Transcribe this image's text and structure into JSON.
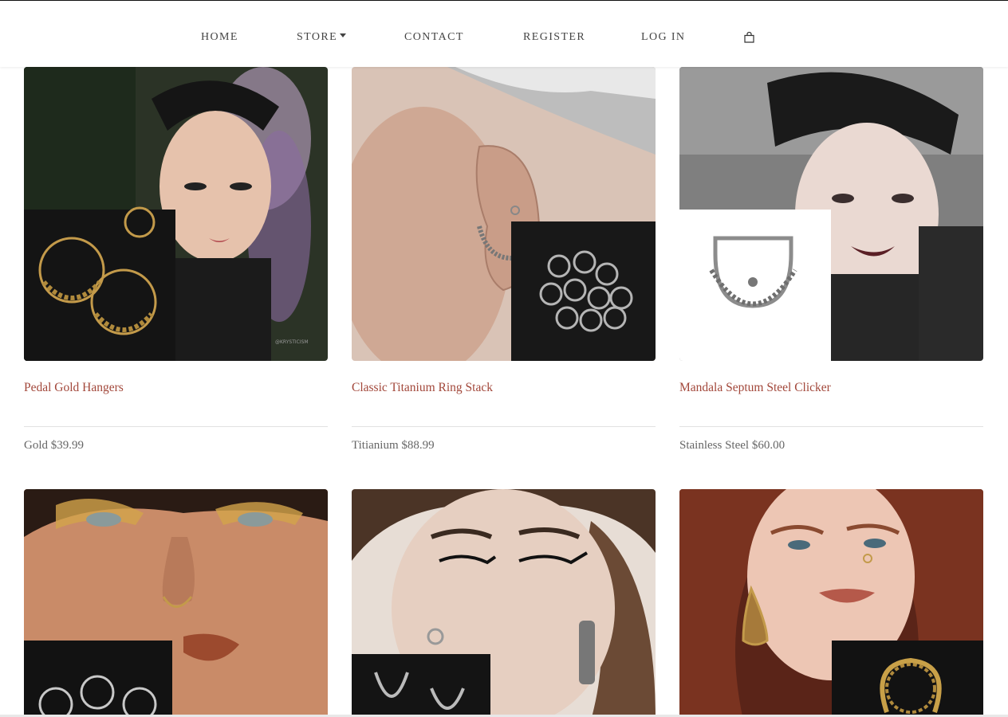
{
  "nav": {
    "home": "HOME",
    "store": "STORE",
    "contact": "CONTACT",
    "register": "REGISTER",
    "login": "LOG IN",
    "cart_icon": "shopping-bag-icon"
  },
  "products": [
    {
      "title": "Pedal Gold Hangers",
      "price": "Gold $39.99",
      "watermark": "@KRYSTICISM"
    },
    {
      "title": "Classic Titanium Ring Stack",
      "price": "Titianium $88.99"
    },
    {
      "title": "Mandala Septum Steel Clicker",
      "price": "Stainless Steel $60.00"
    },
    {
      "title": "",
      "price": ""
    },
    {
      "title": "",
      "price": ""
    },
    {
      "title": "",
      "price": ""
    }
  ],
  "colors": {
    "title_link": "#a2473a",
    "nav_text": "#444444",
    "price_text": "#666666"
  }
}
